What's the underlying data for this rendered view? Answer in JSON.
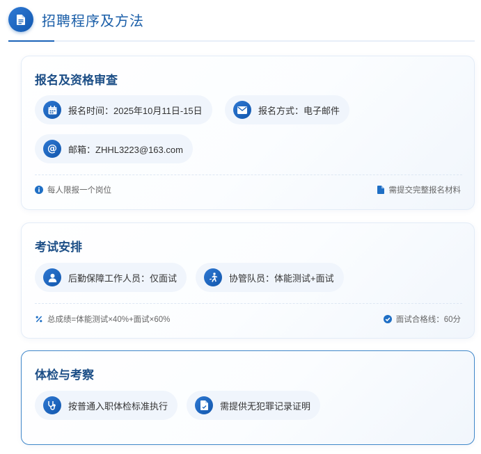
{
  "section": {
    "title": "招聘程序及方法",
    "icon": "document-icon"
  },
  "colors": {
    "accent": "#1a63b8",
    "title": "#1c4e86",
    "chip_bg": "#f0f5fc"
  },
  "registration": {
    "title": "报名及资格审查",
    "time": "报名时间：2025年10月11日-15日",
    "method": "报名方式：电子邮件",
    "email": "邮箱：ZHHL3223@163.com",
    "note_left": "每人限报一个岗位",
    "note_right": "需提交完整报名材料"
  },
  "exam": {
    "title": "考试安排",
    "logistics": "后勤保障工作人员：仅面试",
    "assistant": "协管队员：体能测试+面试",
    "note_left": "总成绩=体能测试×40%+面试×60%",
    "note_right": "面试合格线：60分"
  },
  "physical": {
    "title": "体检与考察",
    "medical": "按普通入职体检标准执行",
    "record": "需提供无犯罪记录证明"
  }
}
